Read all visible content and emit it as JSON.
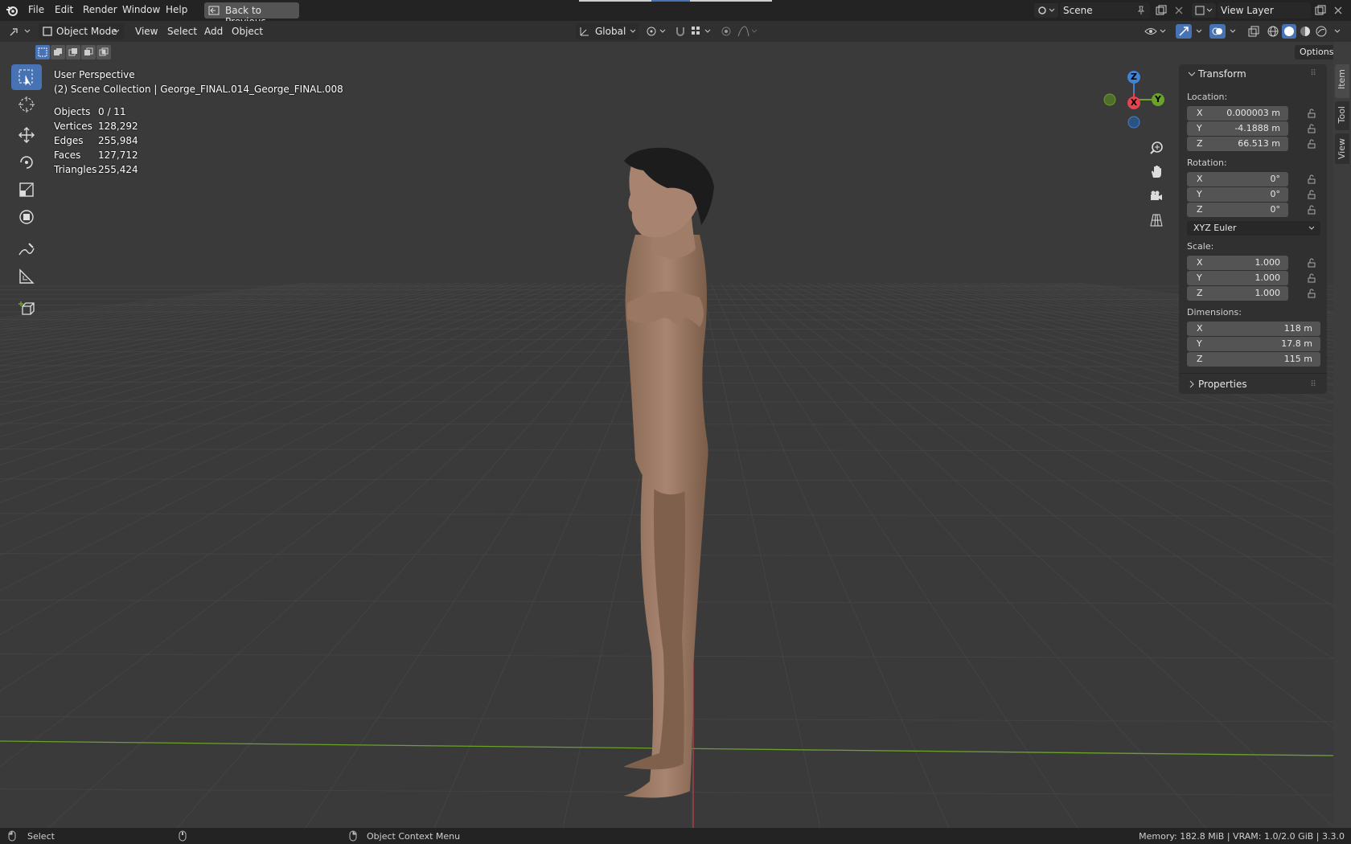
{
  "menu": {
    "file": "File",
    "edit": "Edit",
    "render": "Render",
    "window": "Window",
    "help": "Help",
    "back_to_previous": "Back to Previous"
  },
  "scene": {
    "label": "Scene"
  },
  "view_layer": {
    "label": "View Layer"
  },
  "header": {
    "mode": "Object Mode",
    "view": "View",
    "select": "Select",
    "add": "Add",
    "object": "Object",
    "transform_orientation": "Global",
    "options": "Options"
  },
  "overlay": {
    "perspective": "User Perspective",
    "collection": "(2) Scene Collection | George_FINAL.014_George_FINAL.008",
    "stats": [
      {
        "label": "Objects",
        "value": "0 / 11"
      },
      {
        "label": "Vertices",
        "value": "128,292"
      },
      {
        "label": "Edges",
        "value": "255,984"
      },
      {
        "label": "Faces",
        "value": "127,712"
      },
      {
        "label": "Triangles",
        "value": "255,424"
      }
    ]
  },
  "gizmo": {
    "z": "Z",
    "y": "Y",
    "x": "X"
  },
  "transform": {
    "title": "Transform",
    "location_label": "Location:",
    "location": [
      {
        "axis": "X",
        "value": "0.000003 m"
      },
      {
        "axis": "Y",
        "value": "-4.1888 m"
      },
      {
        "axis": "Z",
        "value": "66.513 m"
      }
    ],
    "rotation_label": "Rotation:",
    "rotation": [
      {
        "axis": "X",
        "value": "0°"
      },
      {
        "axis": "Y",
        "value": "0°"
      },
      {
        "axis": "Z",
        "value": "0°"
      }
    ],
    "rotation_mode": "XYZ Euler",
    "scale_label": "Scale:",
    "scale": [
      {
        "axis": "X",
        "value": "1.000"
      },
      {
        "axis": "Y",
        "value": "1.000"
      },
      {
        "axis": "Z",
        "value": "1.000"
      }
    ],
    "dimensions_label": "Dimensions:",
    "dimensions": [
      {
        "axis": "X",
        "value": "118 m"
      },
      {
        "axis": "Y",
        "value": "17.8 m"
      },
      {
        "axis": "Z",
        "value": "115 m"
      }
    ]
  },
  "properties": {
    "title": "Properties"
  },
  "sidetabs": {
    "item": "Item",
    "tool": "Tool",
    "view": "View"
  },
  "status": {
    "select": "Select",
    "context_menu": "Object Context Menu",
    "memory": "Memory: 182.8 MiB | VRAM: 1.0/2.0 GiB | 3.3.0"
  },
  "colors": {
    "accent": "#4772b3",
    "axis_x": "#e54350",
    "axis_y": "#6aa22b",
    "axis_z": "#3f82d6",
    "skin": "#a17c64",
    "hair": "#1c1c1c"
  }
}
